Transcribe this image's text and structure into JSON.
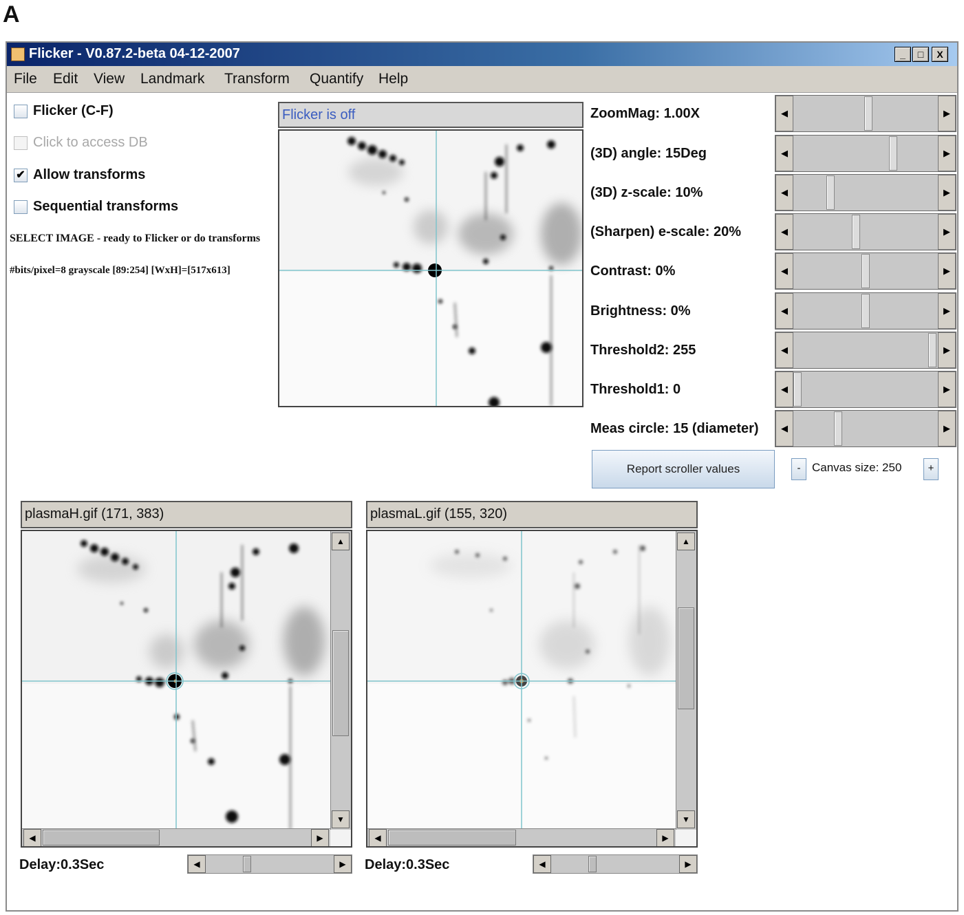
{
  "figure_label": "A",
  "window": {
    "title": "Flicker - V0.87.2-beta 04-12-2007",
    "controls": [
      "_",
      "□",
      "X"
    ]
  },
  "menu": [
    "File",
    "Edit",
    "View",
    "Landmark",
    "Transform",
    "Quantify",
    "Help"
  ],
  "options": {
    "flicker": {
      "label": "Flicker (C-F)",
      "checked": false
    },
    "access_db": {
      "label": "Click to access DB",
      "checked": false,
      "enabled": false
    },
    "allow_transforms": {
      "label": "Allow transforms",
      "checked": true
    },
    "sequential_transforms": {
      "label": "Sequential transforms",
      "checked": false
    }
  },
  "status": {
    "select_image": "SELECT IMAGE - ready to Flicker or do transforms",
    "image_info": "#bits/pixel=8 grayscale [89:254] [WxH]=[517x613]"
  },
  "flicker_panel": {
    "title": "Flicker is off"
  },
  "sliders": [
    {
      "label": "ZoomMag: 1.00X",
      "position": 0.52
    },
    {
      "label": "(3D) angle: 15Deg",
      "position": 0.7
    },
    {
      "label": "(3D) z-scale: 10%",
      "position": 0.24
    },
    {
      "label": "(Sharpen) e-scale: 20%",
      "position": 0.43
    },
    {
      "label": "Contrast: 0%",
      "position": 0.5
    },
    {
      "label": "Brightness: 0%",
      "position": 0.5
    },
    {
      "label": "Threshold2: 255",
      "position": 0.99
    },
    {
      "label": "Threshold1: 0",
      "position": 0.0
    },
    {
      "label": "Meas circle: 15 (diameter)",
      "position": 0.3
    }
  ],
  "report_button": "Report scroller values",
  "canvas": {
    "minus": "-",
    "plus": "+",
    "label": "Canvas size: 250"
  },
  "images": [
    {
      "title": "plasmaH.gif  (171, 383)",
      "delay": "Delay:0.3Sec",
      "vscroll": 0.52,
      "hscroll": 0.0,
      "delay_pos": 0.3
    },
    {
      "title": "plasmaL.gif  (155, 320)",
      "delay": "Delay:0.3Sec",
      "vscroll": 0.36,
      "hscroll": 0.0,
      "delay_pos": 0.3
    }
  ],
  "icons": {
    "app": "java-cup-icon",
    "check": "✔",
    "arrow_left": "◀",
    "arrow_right": "▶",
    "arrow_up": "▲",
    "arrow_down": "▼"
  }
}
